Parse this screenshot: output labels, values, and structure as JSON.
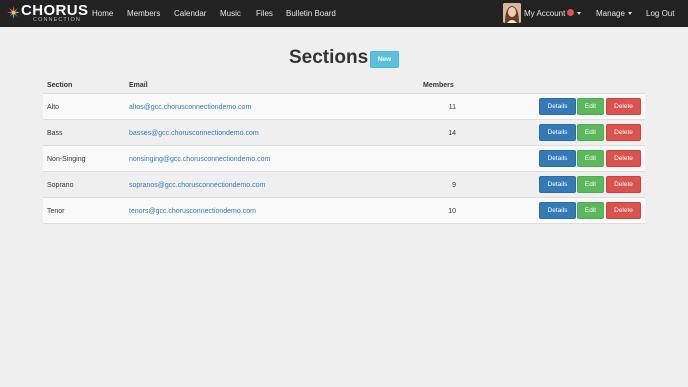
{
  "brand": {
    "name": "CHORUS",
    "tagline": "CONNECTION"
  },
  "nav": {
    "home": "Home",
    "members": "Members",
    "calendar": "Calendar",
    "music": "Music",
    "files": "Files",
    "bulletin_board": "Bulletin Board",
    "my_account": "My Account",
    "manage": "Manage",
    "logout": "Log Out"
  },
  "page": {
    "title": "Sections",
    "new_label": "New"
  },
  "table": {
    "headers": {
      "section": "Section",
      "email": "Email",
      "members": "Members"
    },
    "actions": {
      "details": "Details",
      "edit": "Edit",
      "delete": "Delete"
    },
    "rows": [
      {
        "section": "Alto",
        "email": "altos@gcc.chorusconnectiondemo.com",
        "members": "11"
      },
      {
        "section": "Bass",
        "email": "basses@gcc.chorusconnectiondemo.com",
        "members": "14"
      },
      {
        "section": "Non-Singing",
        "email": "nonsinging@gcc.chorusconnectiondemo.com",
        "members": ""
      },
      {
        "section": "Soprano",
        "email": "sopranos@gcc.chorusconnectiondemo.com",
        "members": "9"
      },
      {
        "section": "Tenor",
        "email": "tenors@gcc.chorusconnectiondemo.com",
        "members": "10"
      }
    ]
  },
  "colors": {
    "navbar": "#222222",
    "info": "#5bc0de",
    "primary": "#337ab7",
    "success": "#5cb85c",
    "danger": "#d9534f"
  },
  "icons": {
    "logo": "chorus-logo-icon",
    "avatar": "user-avatar",
    "badge": "notification-badge-icon",
    "caret": "caret-down-icon"
  }
}
